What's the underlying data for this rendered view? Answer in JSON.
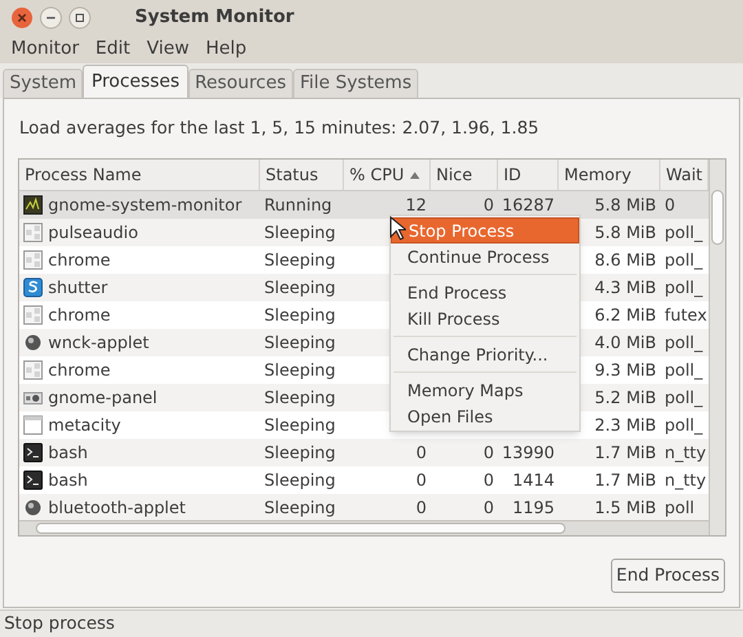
{
  "window": {
    "title": "System Monitor"
  },
  "menubar": [
    "Monitor",
    "Edit",
    "View",
    "Help"
  ],
  "tabs": [
    {
      "label": "System",
      "selected": false
    },
    {
      "label": "Processes",
      "selected": true
    },
    {
      "label": "Resources",
      "selected": false
    },
    {
      "label": "File Systems",
      "selected": false
    }
  ],
  "load_averages": "Load averages for the last 1, 5, 15 minutes: 2.07, 1.96, 1.85",
  "table": {
    "columns": [
      {
        "label": "Process Name",
        "sorted": false
      },
      {
        "label": "Status",
        "sorted": false
      },
      {
        "label": "% CPU",
        "sorted": true
      },
      {
        "label": "Nice",
        "sorted": false
      },
      {
        "label": "ID",
        "sorted": false
      },
      {
        "label": "Memory",
        "sorted": false
      },
      {
        "label": "Wait",
        "sorted": false
      }
    ],
    "rows": [
      {
        "kind": "monitor",
        "selected": true,
        "cells": {
          "name": "gnome-system-monitor",
          "status": "Running",
          "cpu": "12",
          "nice": "0",
          "id": "16287",
          "memory": "5.8 MiB",
          "wait": "0"
        }
      },
      {
        "kind": "generic",
        "selected": false,
        "cells": {
          "name": "pulseaudio",
          "status": "Sleeping",
          "memory": "5.8 MiB",
          "wait": "poll_"
        }
      },
      {
        "kind": "generic",
        "selected": false,
        "cells": {
          "name": "chrome",
          "status": "Sleeping",
          "memory": "8.6 MiB",
          "wait": "poll_"
        }
      },
      {
        "kind": "shutter",
        "selected": false,
        "cells": {
          "name": "shutter",
          "status": "Sleeping",
          "memory": "4.3 MiB",
          "wait": "poll_"
        }
      },
      {
        "kind": "generic",
        "selected": false,
        "cells": {
          "name": "chrome",
          "status": "Sleeping",
          "memory": "6.2 MiB",
          "wait": "futex"
        }
      },
      {
        "kind": "orb",
        "selected": false,
        "cells": {
          "name": "wnck-applet",
          "status": "Sleeping",
          "memory": "4.0 MiB",
          "wait": "poll_"
        }
      },
      {
        "kind": "generic",
        "selected": false,
        "cells": {
          "name": "chrome",
          "status": "Sleeping",
          "memory": "9.3 MiB",
          "wait": "poll_"
        }
      },
      {
        "kind": "panel",
        "selected": false,
        "cells": {
          "name": "gnome-panel",
          "status": "Sleeping",
          "memory": "5.2 MiB",
          "wait": "poll_"
        }
      },
      {
        "kind": "window",
        "selected": false,
        "cells": {
          "name": "metacity",
          "status": "Sleeping",
          "memory": "2.3 MiB",
          "wait": "poll_"
        }
      },
      {
        "kind": "terminal",
        "selected": false,
        "cells": {
          "name": "bash",
          "status": "Sleeping",
          "cpu": "0",
          "nice": "0",
          "id": "13990",
          "memory": "1.7 MiB",
          "wait": "n_tty"
        }
      },
      {
        "kind": "terminal",
        "selected": false,
        "cells": {
          "name": "bash",
          "status": "Sleeping",
          "cpu": "0",
          "nice": "0",
          "id": "1414",
          "memory": "1.7 MiB",
          "wait": "n_tty"
        }
      },
      {
        "kind": "orb",
        "selected": false,
        "cells": {
          "name": "bluetooth-applet",
          "status": "Sleeping",
          "cpu": "0",
          "nice": "0",
          "id": "1195",
          "memory": "1.5 MiB",
          "wait": "poll"
        }
      }
    ]
  },
  "context_menu": {
    "items": [
      {
        "kind": "item",
        "label": "Stop Process",
        "selected": true
      },
      {
        "kind": "item",
        "label": "Continue Process",
        "selected": false
      },
      {
        "kind": "separator"
      },
      {
        "kind": "item",
        "label": "End Process",
        "selected": false
      },
      {
        "kind": "item",
        "label": "Kill Process",
        "selected": false
      },
      {
        "kind": "separator"
      },
      {
        "kind": "item",
        "label": "Change Priority...",
        "selected": false
      },
      {
        "kind": "separator"
      },
      {
        "kind": "item",
        "label": "Memory Maps",
        "selected": false
      },
      {
        "kind": "item",
        "label": "Open Files",
        "selected": false
      }
    ]
  },
  "end_button": "End Process",
  "status_bar": "Stop process"
}
